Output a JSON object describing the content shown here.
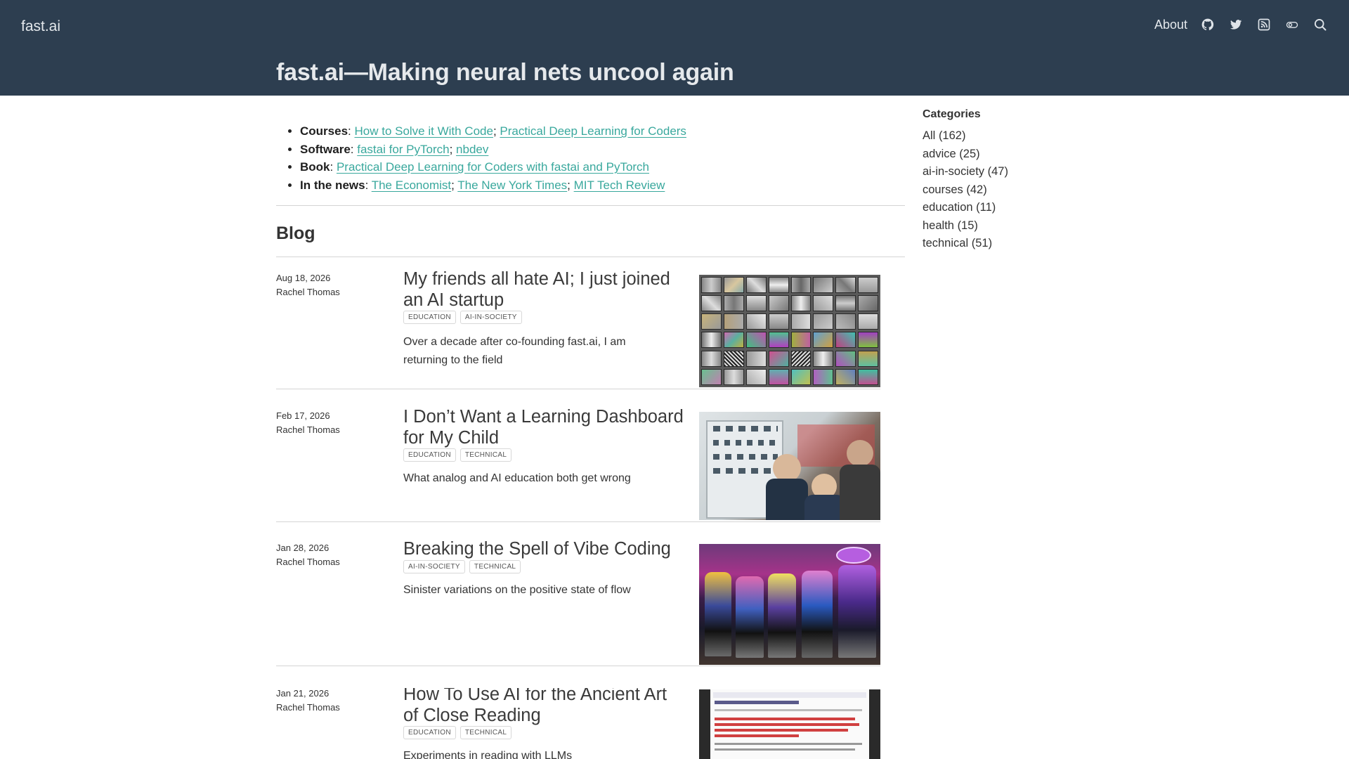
{
  "header": {
    "brand": "fast.ai",
    "about_label": "About",
    "icons": [
      "github-icon",
      "twitter-icon",
      "rss-icon",
      "toggle-icon",
      "search-icon"
    ],
    "hero_title": "fast.ai—Making neural nets uncool again",
    "bg_color": "#2d3e50"
  },
  "intro": {
    "courses": {
      "label": "Courses",
      "links": [
        "How to Solve it With Code",
        "Practical Deep Learning for Coders"
      ]
    },
    "software": {
      "label": "Software",
      "links": [
        "fastai for PyTorch",
        "nbdev"
      ]
    },
    "book": {
      "label": "Book",
      "links": [
        "Practical Deep Learning for Coders with fastai and PyTorch"
      ]
    },
    "news": {
      "label": "In the news",
      "links": [
        "The Economist",
        "The New York Times",
        "MIT Tech Review"
      ]
    },
    "link_color": "#39a89d"
  },
  "blog": {
    "heading": "Blog",
    "posts": [
      {
        "date": "Aug 18, 2026",
        "author": "Rachel Thomas",
        "title": "My friends all hate AI; I just joined an AI startup",
        "tags": [
          "education",
          "ai-in-society"
        ],
        "description": "Over a decade after co-founding fast.ai, I am returning to the field"
      },
      {
        "date": "Feb 17, 2026",
        "author": "Rachel Thomas",
        "title": "I Don’t Want a Learning Dashboard for My Child",
        "tags": [
          "education",
          "technical"
        ],
        "description": "What analog and AI education both get wrong"
      },
      {
        "date": "Jan 28, 2026",
        "author": "Rachel Thomas",
        "title": "Breaking the Spell of Vibe Coding",
        "tags": [
          "ai-in-society",
          "technical"
        ],
        "description": "Sinister variations on the positive state of flow"
      },
      {
        "date": "Jan 21, 2026",
        "author": "Rachel Thomas",
        "title": "How To Use AI for the Ancient Art of Close Reading",
        "tags": [
          "education",
          "technical"
        ],
        "description": "Experiments in reading with LLMs"
      }
    ]
  },
  "sidebar": {
    "title": "Categories",
    "items": [
      {
        "name": "All",
        "count": "(162)"
      },
      {
        "name": "advice",
        "count": "(25)"
      },
      {
        "name": "ai-in-society",
        "count": "(47)"
      },
      {
        "name": "courses",
        "count": "(42)"
      },
      {
        "name": "education",
        "count": "(11)"
      },
      {
        "name": "health",
        "count": "(15)"
      },
      {
        "name": "technical",
        "count": "(51)"
      }
    ]
  }
}
